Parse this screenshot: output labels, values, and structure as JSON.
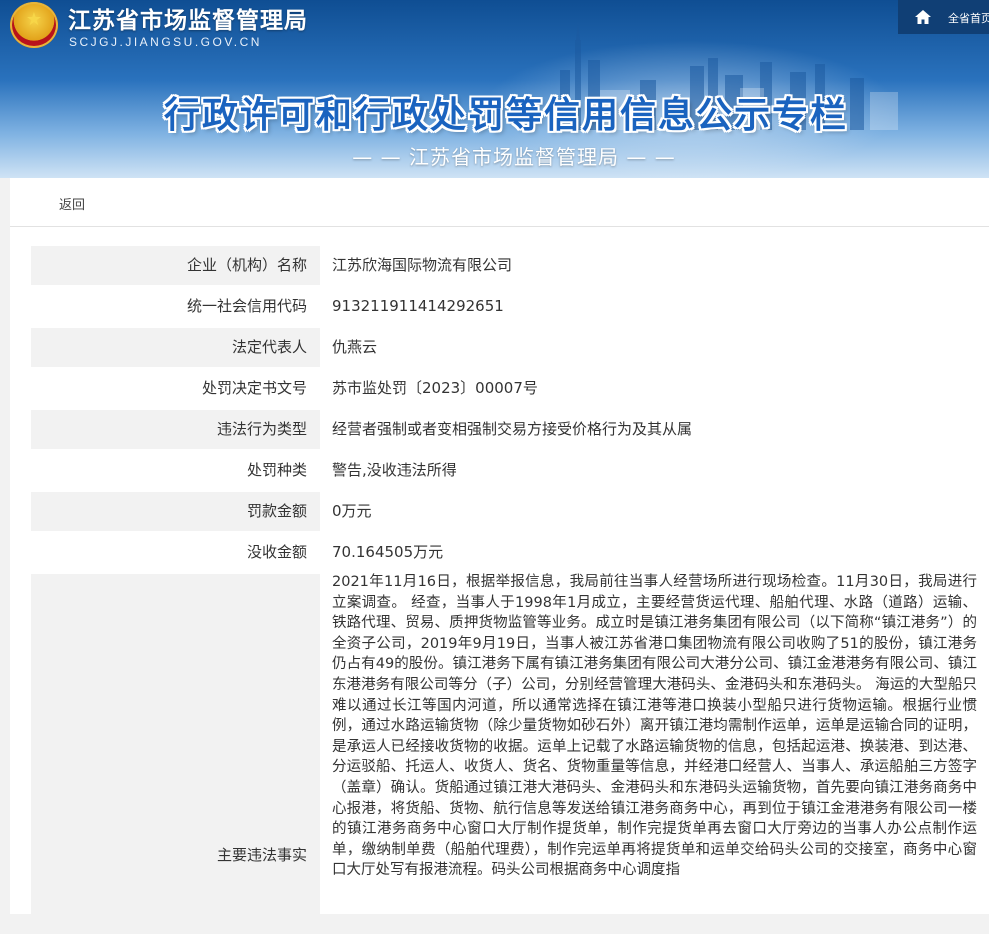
{
  "header": {
    "site_name": "江苏省市场监督管理局",
    "site_domain": "SCJGJ.JIANGSU.GOV.CN",
    "home_label": "全省首页",
    "headline": "行政许可和行政处罚等信用信息公示专栏",
    "subline": "— — 江苏省市场监督管理局 — —"
  },
  "nav": {
    "back_label": "返回"
  },
  "details": [
    {
      "label": "企业（机构）名称",
      "value": "江苏欣海国际物流有限公司"
    },
    {
      "label": "统一社会信用代码",
      "value": "913211911414292651"
    },
    {
      "label": "法定代表人",
      "value": "仇燕云"
    },
    {
      "label": "处罚决定书文号",
      "value": "苏市监处罚〔2023〕00007号"
    },
    {
      "label": "违法行为类型",
      "value": "经营者强制或者变相强制交易方接受价格行为及其从属"
    },
    {
      "label": "处罚种类",
      "value": "警告,没收违法所得"
    },
    {
      "label": "罚款金额",
      "value": "0万元"
    },
    {
      "label": "没收金额",
      "value": "70.164505万元"
    }
  ],
  "facts": {
    "label": "主要违法事实",
    "text": "2021年11月16日，根据举报信息，我局前往当事人经营场所进行现场检查。11月30日，我局进行立案调查。 经查，当事人于1998年1月成立，主要经营货运代理、船舶代理、水路（道路）运输、铁路代理、贸易、质押货物监管等业务。成立时是镇江港务集团有限公司（以下简称“镇江港务”）的全资子公司，2019年9月19日，当事人被江苏省港口集团物流有限公司收购了51的股份，镇江港务仍占有49的股份。镇江港务下属有镇江港务集团有限公司大港分公司、镇江金港港务有限公司、镇江东港港务有限公司等分（子）公司，分别经营管理大港码头、金港码头和东港码头。 海运的大型船只难以通过长江等国内河道，所以通常选择在镇江港等港口换装小型船只进行货物运输。根据行业惯例，通过水路运输货物（除少量货物如砂石外）离开镇江港均需制作运单，运单是运输合同的证明，是承运人已经接收货物的收据。运单上记载了水路运输货物的信息，包括起运港、换装港、到达港、分运驳船、托运人、收货人、货名、货物重量等信息，并经港口经营人、当事人、承运船舶三方签字（盖章）确认。货船通过镇江港大港码头、金港码头和东港码头运输货物，首先要向镇江港务商务中心报港，将货船、货物、航行信息等发送给镇江港务商务中心，再到位于镇江金港港务有限公司一楼的镇江港务商务中心窗口大厅制作提货单，制作完提货单再去窗口大厅旁边的当事人办公点制作运单，缴纳制单费（船舶代理费），制作完运单再将提货单和运单交给码头公司的交接室，商务中心窗口大厅处写有报港流程。码头公司根据商务中心调度指"
  }
}
